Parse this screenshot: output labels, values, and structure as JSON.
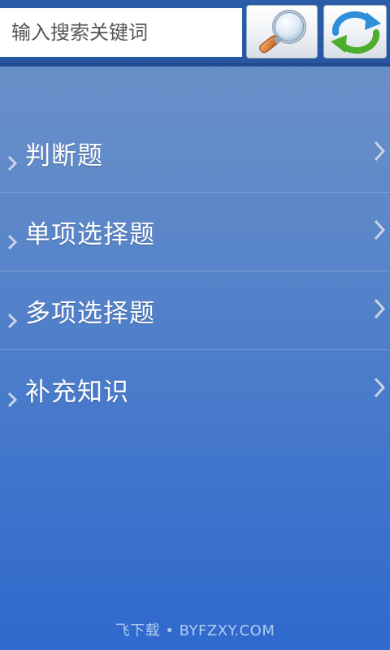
{
  "search": {
    "placeholder": "输入搜索关键词",
    "search_icon": "magnifier-icon",
    "refresh_icon": "refresh-icon"
  },
  "menu": {
    "items": [
      {
        "label": "判断题"
      },
      {
        "label": "单项选择题"
      },
      {
        "label": "多项选择题"
      },
      {
        "label": "补充知识"
      }
    ]
  },
  "footer": {
    "watermark": "飞下载 • BYFZXY.COM"
  },
  "colors": {
    "topbar": "#2b5da8",
    "background_top": "#6f93c8",
    "background_bottom": "#2f69cd",
    "text": "#ffffff"
  }
}
